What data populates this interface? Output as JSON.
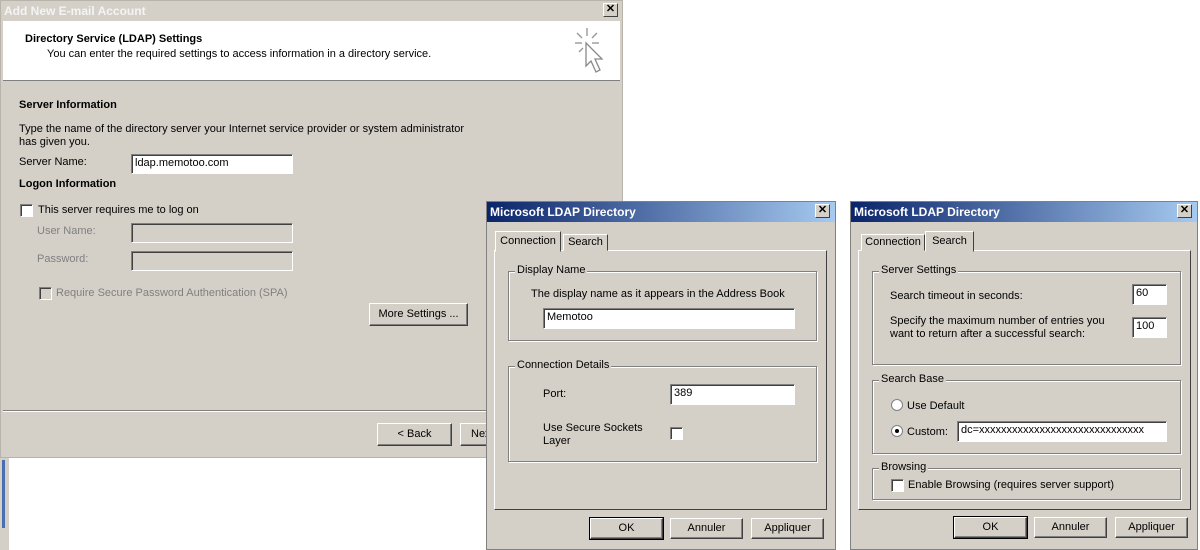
{
  "main": {
    "title": "Add New E-mail Account",
    "header_title": "Directory Service (LDAP) Settings",
    "header_subtitle": "You can enter the required settings to access information in a directory service.",
    "server_section": "Server Information",
    "server_desc_line1": "Type the name of the directory server your Internet service provider or system administrator",
    "server_desc_line2": "has given you.",
    "server_name_label": "Server Name:",
    "server_name_value": "ldap.memotoo.com",
    "logon_section": "Logon Information",
    "logon_checkbox_label": "This server requires me to log on",
    "username_label": "User Name:",
    "password_label": "Password:",
    "spa_label": "Require Secure Password Authentication (SPA)",
    "more_settings_button": "More Settings ...",
    "back_button": "< Back",
    "next_button_partial": "Nex"
  },
  "dialog_connection": {
    "title": "Microsoft LDAP Directory",
    "tabs": [
      "Connection",
      "Search"
    ],
    "display_name_group": "Display Name",
    "display_name_desc": "The display name as it appears in the Address Book",
    "display_name_value": "Memotoo",
    "connection_group": "Connection Details",
    "port_label": "Port:",
    "port_value": "389",
    "ssl_label_line1": "Use Secure Sockets",
    "ssl_label_line2": "Layer",
    "buttons": {
      "ok": "OK",
      "cancel": "Annuler",
      "apply": "Appliquer"
    }
  },
  "dialog_search": {
    "title": "Microsoft LDAP Directory",
    "tabs": [
      "Connection",
      "Search"
    ],
    "server_settings_group": "Server Settings",
    "timeout_label": "Search timeout in seconds:",
    "timeout_value": "60",
    "max_entries_line1": "Specify the maximum number of entries you",
    "max_entries_line2": "want to return after a successful search:",
    "max_entries_value": "100",
    "search_base_group": "Search Base",
    "use_default_label": "Use Default",
    "custom_label": "Custom:",
    "custom_value": "dc=xxxxxxxxxxxxxxxxxxxxxxxxxxxxxx",
    "browsing_group": "Browsing",
    "enable_browsing_label": "Enable Browsing (requires server support)",
    "buttons": {
      "ok": "OK",
      "cancel": "Annuler",
      "apply": "Appliquer"
    }
  }
}
